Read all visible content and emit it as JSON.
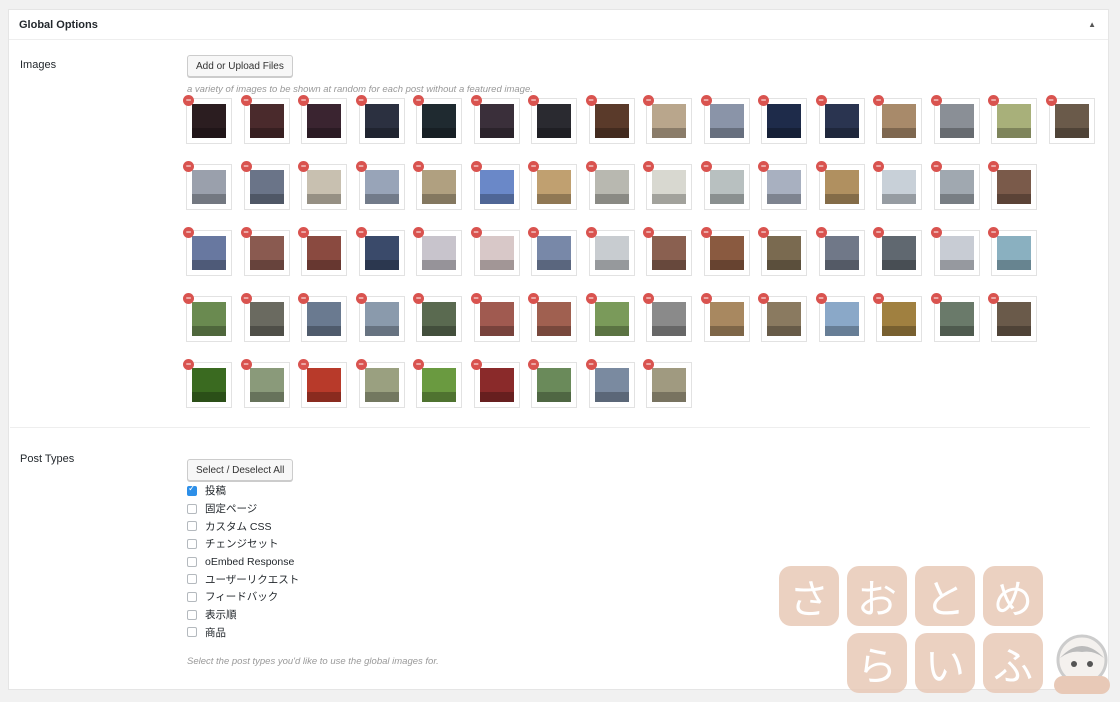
{
  "panel": {
    "title": "Global Options",
    "toggle_icon": "▲"
  },
  "images": {
    "label": "Images",
    "upload_button": "Add or Upload Files",
    "description": "a variety of images to be shown at random for each post without a featured image.",
    "thumbnails": [
      "#2b1d20",
      "#4a2a2c",
      "#3a2430",
      "#2b3040",
      "#1f2a30",
      "#3a2f3a",
      "#2a2a30",
      "#5a3a2a",
      "#b9a68c",
      "#8a94a8",
      "#1e2b4a",
      "#2a3450",
      "#a88a6a",
      "#8a8f96",
      "#a8b07a",
      "#6a5a4a",
      "#9aa0ac",
      "#6a7488",
      "#c8c0b0",
      "#98a4b8",
      "#b0a080",
      "#6a88c8",
      "#c0a070",
      "#b8b8b0",
      "#d8d8d0",
      "#b8c0c0",
      "#a8b0c0",
      "#b09060",
      "#c8d0d8",
      "#a0a8b0",
      "#7a5a4a",
      "#6878a0",
      "#8a5a50",
      "#8a4a40",
      "#3a4a6a",
      "#c8c4cc",
      "#d8c8c8",
      "#7888a8",
      "#c8ccd0",
      "#8a6050",
      "#8a5a40",
      "#7a6a50",
      "#707888",
      "#606870",
      "#c8ccd4",
      "#8ab0c0",
      "#6a8a50",
      "#6a6a60",
      "#6a7a90",
      "#8a9aac",
      "#5a6a50",
      "#a05a50",
      "#a06050",
      "#7a9a5a",
      "#8a8a8a",
      "#a88860",
      "#8a7a60",
      "#8aa8c8",
      "#a08040",
      "#6a7a6a",
      "#6a5a4a",
      "#3a6a20",
      "#8a9a7a",
      "#b83a2a",
      "#9aa080",
      "#6a9a40",
      "#8a2a2a",
      "#6a8a5a",
      "#7a8aa0",
      "#a09a80"
    ]
  },
  "post_types": {
    "label": "Post Types",
    "select_button": "Select / Deselect All",
    "items": [
      {
        "label": "投稿",
        "checked": true
      },
      {
        "label": "固定ページ",
        "checked": false
      },
      {
        "label": "カスタム CSS",
        "checked": false
      },
      {
        "label": "チェンジセット",
        "checked": false
      },
      {
        "label": "oEmbed Response",
        "checked": false
      },
      {
        "label": "ユーザーリクエスト",
        "checked": false
      },
      {
        "label": "フィードバック",
        "checked": false
      },
      {
        "label": "表示順",
        "checked": false
      },
      {
        "label": "商品",
        "checked": false
      }
    ],
    "description": "Select the post types you'd like to use the global images for."
  },
  "watermark": {
    "row1": [
      "さ",
      "お",
      "と",
      "め"
    ],
    "row2": [
      "ら",
      "い",
      "ふ"
    ]
  }
}
